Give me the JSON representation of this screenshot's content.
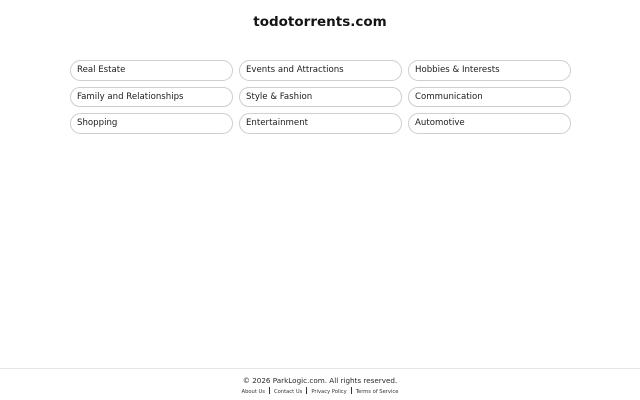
{
  "header": {
    "site_name": "todotorrents.com"
  },
  "categories": [
    {
      "label": "Real Estate"
    },
    {
      "label": "Events and Attractions"
    },
    {
      "label": "Hobbies & Interests"
    },
    {
      "label": "Family and Relationships"
    },
    {
      "label": "Style & Fashion"
    },
    {
      "label": "Communication"
    },
    {
      "label": "Shopping"
    },
    {
      "label": "Entertainment"
    },
    {
      "label": "Automotive"
    }
  ],
  "footer": {
    "copyright": "© 2026 ParkLogic.com. All rights reserved.",
    "links": [
      {
        "label": "About Us"
      },
      {
        "label": "Contact Us"
      },
      {
        "label": "Privacy Policy"
      },
      {
        "label": "Terms of Service"
      }
    ]
  }
}
